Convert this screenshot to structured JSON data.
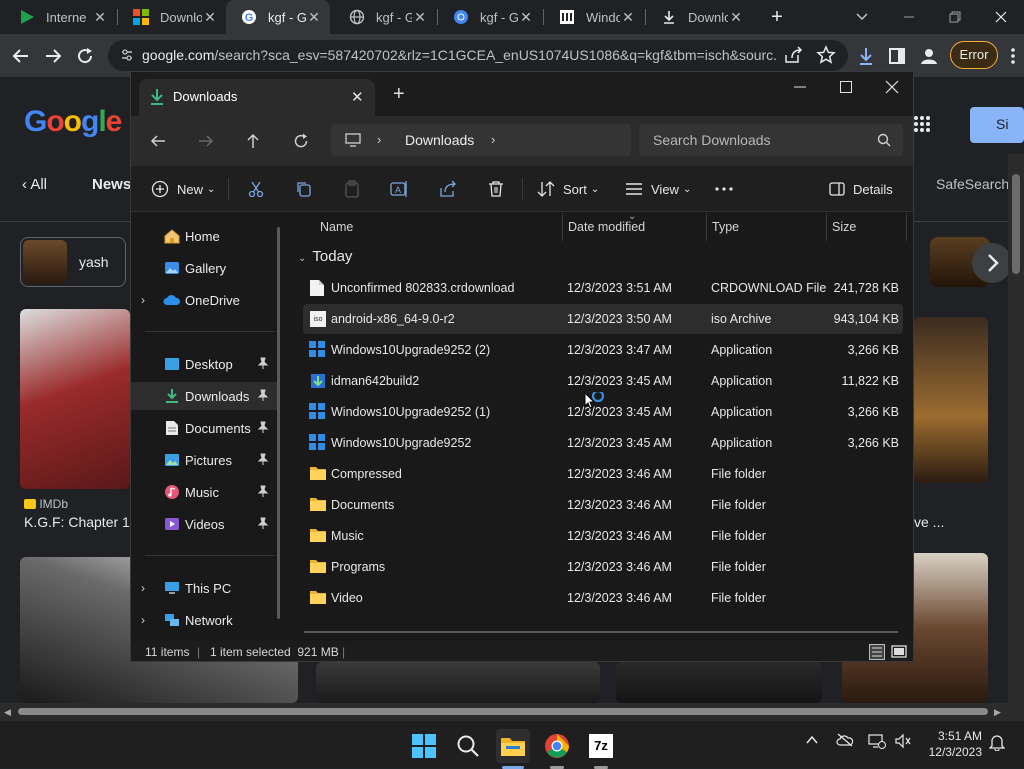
{
  "browser": {
    "tabs": [
      {
        "title": "Interne",
        "icon": "play-icon"
      },
      {
        "title": "Downlo",
        "icon": "windows-icon"
      },
      {
        "title": "kgf - Go",
        "icon": "google-icon"
      },
      {
        "title": "kgf - Go",
        "icon": "globe-icon"
      },
      {
        "title": "kgf - Go",
        "icon": "chrome-icon"
      },
      {
        "title": "Window",
        "icon": "bank-icon"
      },
      {
        "title": "Downlo",
        "icon": "download-icon"
      }
    ],
    "url_domain": "google.com",
    "url_rest": "/search?sca_esv=587420702&rlz=1C1GCEA_enUS1074US1086&q=kgf&tbm=isch&sourc...",
    "error_label": "Error"
  },
  "google": {
    "logo": "Google",
    "all_label": "All",
    "news_label": "News",
    "safesearch_label": "SafeSearch",
    "chip_label": "yash",
    "signin_partial": "Si",
    "result_source": "IMDb",
    "result_title": "K.G.F: Chapter 1",
    "result_right_partial": "ve ..."
  },
  "explorer": {
    "tab_title": "Downloads",
    "breadcrumb": "Downloads",
    "search_placeholder": "Search Downloads",
    "commands": {
      "new": "New",
      "sort": "Sort",
      "view": "View",
      "details": "Details"
    },
    "nav": [
      {
        "label": "Home"
      },
      {
        "label": "Gallery"
      },
      {
        "label": "OneDrive"
      },
      {
        "label": "Desktop"
      },
      {
        "label": "Downloads"
      },
      {
        "label": "Documents"
      },
      {
        "label": "Pictures"
      },
      {
        "label": "Music"
      },
      {
        "label": "Videos"
      },
      {
        "label": "This PC"
      },
      {
        "label": "Network"
      }
    ],
    "columns": {
      "name": "Name",
      "date": "Date modified",
      "type": "Type",
      "size": "Size"
    },
    "group": "Today",
    "files": [
      {
        "name": "Unconfirmed 802833.crdownload",
        "date": "12/3/2023 3:51 AM",
        "type": "CRDOWNLOAD File",
        "size": "241,728 KB",
        "icon": "file-icon"
      },
      {
        "name": "android-x86_64-9.0-r2",
        "date": "12/3/2023 3:50 AM",
        "type": "iso Archive",
        "size": "943,104 KB",
        "icon": "iso-icon"
      },
      {
        "name": "Windows10Upgrade9252 (2)",
        "date": "12/3/2023 3:47 AM",
        "type": "Application",
        "size": "3,266 KB",
        "icon": "windows-app-icon"
      },
      {
        "name": "idman642build2",
        "date": "12/3/2023 3:45 AM",
        "type": "Application",
        "size": "11,822 KB",
        "icon": "idm-icon"
      },
      {
        "name": "Windows10Upgrade9252 (1)",
        "date": "12/3/2023 3:45 AM",
        "type": "Application",
        "size": "3,266 KB",
        "icon": "windows-app-icon"
      },
      {
        "name": "Windows10Upgrade9252",
        "date": "12/3/2023 3:45 AM",
        "type": "Application",
        "size": "3,266 KB",
        "icon": "windows-app-icon"
      },
      {
        "name": "Compressed",
        "date": "12/3/2023 3:46 AM",
        "type": "File folder",
        "size": "",
        "icon": "folder-icon"
      },
      {
        "name": "Documents",
        "date": "12/3/2023 3:46 AM",
        "type": "File folder",
        "size": "",
        "icon": "folder-icon"
      },
      {
        "name": "Music",
        "date": "12/3/2023 3:46 AM",
        "type": "File folder",
        "size": "",
        "icon": "folder-icon"
      },
      {
        "name": "Programs",
        "date": "12/3/2023 3:46 AM",
        "type": "File folder",
        "size": "",
        "icon": "folder-icon"
      },
      {
        "name": "Video",
        "date": "12/3/2023 3:46 AM",
        "type": "File folder",
        "size": "",
        "icon": "folder-icon"
      }
    ],
    "status_items": "11 items",
    "status_selected": "1 item selected  921 MB"
  },
  "taskbar": {
    "time": "3:51 AM",
    "date": "12/3/2023",
    "apps": [
      "start-icon",
      "search-icon",
      "file-explorer-icon",
      "chrome-icon",
      "7zip-icon"
    ],
    "sevenzip_label": "7z"
  }
}
